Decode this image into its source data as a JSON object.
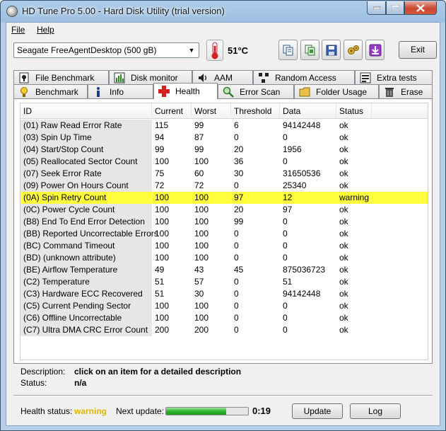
{
  "window": {
    "title": "HD Tune Pro 5.00 - Hard Disk Utility (trial version)"
  },
  "menu": {
    "file": "File",
    "help": "Help"
  },
  "toolbar": {
    "drive": "Seagate FreeAgentDesktop (500 gB)",
    "temperature": "51°C",
    "exit_label": "Exit",
    "buttons": [
      "copy-icon",
      "copy-screenshot-icon",
      "save-icon",
      "options-icon",
      "download-icon"
    ]
  },
  "tabs_top": [
    {
      "label": "File Benchmark",
      "icon": "file-benchmark-icon"
    },
    {
      "label": "Disk monitor",
      "icon": "disk-monitor-icon"
    },
    {
      "label": "AAM",
      "icon": "speaker-icon"
    },
    {
      "label": "Random Access",
      "icon": "random-access-icon"
    },
    {
      "label": "Extra tests",
      "icon": "extra-tests-icon"
    }
  ],
  "tabs_bottom": [
    {
      "label": "Benchmark",
      "icon": "benchmark-icon"
    },
    {
      "label": "Info",
      "icon": "info-icon"
    },
    {
      "label": "Health",
      "icon": "health-cross-icon",
      "active": true
    },
    {
      "label": "Error Scan",
      "icon": "magnifier-icon"
    },
    {
      "label": "Folder Usage",
      "icon": "folder-icon"
    },
    {
      "label": "Erase",
      "icon": "trash-icon"
    }
  ],
  "table": {
    "headers": [
      "ID",
      "Current",
      "Worst",
      "Threshold",
      "Data",
      "Status"
    ],
    "rows": [
      {
        "id": "(01) Raw Read Error Rate",
        "current": "115",
        "worst": "99",
        "threshold": "6",
        "data": "94142448",
        "status": "ok"
      },
      {
        "id": "(03) Spin Up Time",
        "current": "94",
        "worst": "87",
        "threshold": "0",
        "data": "0",
        "status": "ok"
      },
      {
        "id": "(04) Start/Stop Count",
        "current": "99",
        "worst": "99",
        "threshold": "20",
        "data": "1956",
        "status": "ok"
      },
      {
        "id": "(05) Reallocated Sector Count",
        "current": "100",
        "worst": "100",
        "threshold": "36",
        "data": "0",
        "status": "ok"
      },
      {
        "id": "(07) Seek Error Rate",
        "current": "75",
        "worst": "60",
        "threshold": "30",
        "data": "31650536",
        "status": "ok"
      },
      {
        "id": "(09) Power On Hours Count",
        "current": "72",
        "worst": "72",
        "threshold": "0",
        "data": "25340",
        "status": "ok"
      },
      {
        "id": "(0A) Spin Retry Count",
        "current": "100",
        "worst": "100",
        "threshold": "97",
        "data": "12",
        "status": "warning",
        "highlight": true
      },
      {
        "id": "(0C) Power Cycle Count",
        "current": "100",
        "worst": "100",
        "threshold": "20",
        "data": "97",
        "status": "ok"
      },
      {
        "id": "(B8) End To End Error Detection",
        "current": "100",
        "worst": "100",
        "threshold": "99",
        "data": "0",
        "status": "ok"
      },
      {
        "id": "(BB) Reported Uncorrectable Errors",
        "current": "100",
        "worst": "100",
        "threshold": "0",
        "data": "0",
        "status": "ok"
      },
      {
        "id": "(BC) Command Timeout",
        "current": "100",
        "worst": "100",
        "threshold": "0",
        "data": "0",
        "status": "ok"
      },
      {
        "id": "(BD) (unknown attribute)",
        "current": "100",
        "worst": "100",
        "threshold": "0",
        "data": "0",
        "status": "ok"
      },
      {
        "id": "(BE) Airflow Temperature",
        "current": "49",
        "worst": "43",
        "threshold": "45",
        "data": "875036723",
        "status": "ok"
      },
      {
        "id": "(C2) Temperature",
        "current": "51",
        "worst": "57",
        "threshold": "0",
        "data": "51",
        "status": "ok"
      },
      {
        "id": "(C3) Hardware ECC Recovered",
        "current": "51",
        "worst": "30",
        "threshold": "0",
        "data": "94142448",
        "status": "ok"
      },
      {
        "id": "(C5) Current Pending Sector",
        "current": "100",
        "worst": "100",
        "threshold": "0",
        "data": "0",
        "status": "ok"
      },
      {
        "id": "(C6) Offline Uncorrectable",
        "current": "100",
        "worst": "100",
        "threshold": "0",
        "data": "0",
        "status": "ok"
      },
      {
        "id": "(C7) Ultra DMA CRC Error Count",
        "current": "200",
        "worst": "200",
        "threshold": "0",
        "data": "0",
        "status": "ok"
      }
    ]
  },
  "details": {
    "description_label": "Description:",
    "description_value": "click on an item for a detailed description",
    "status_label": "Status:",
    "status_value": "n/a"
  },
  "footer": {
    "health_label": "Health status:",
    "health_value": "warning",
    "next_update_label": "Next update:",
    "countdown": "0:19",
    "progress_fraction": 0.73,
    "update_label": "Update",
    "log_label": "Log"
  },
  "colors": {
    "warning_highlight": "#fffd3c",
    "health_warning_text": "#e0b400",
    "progress_green": "#2fb42f"
  }
}
